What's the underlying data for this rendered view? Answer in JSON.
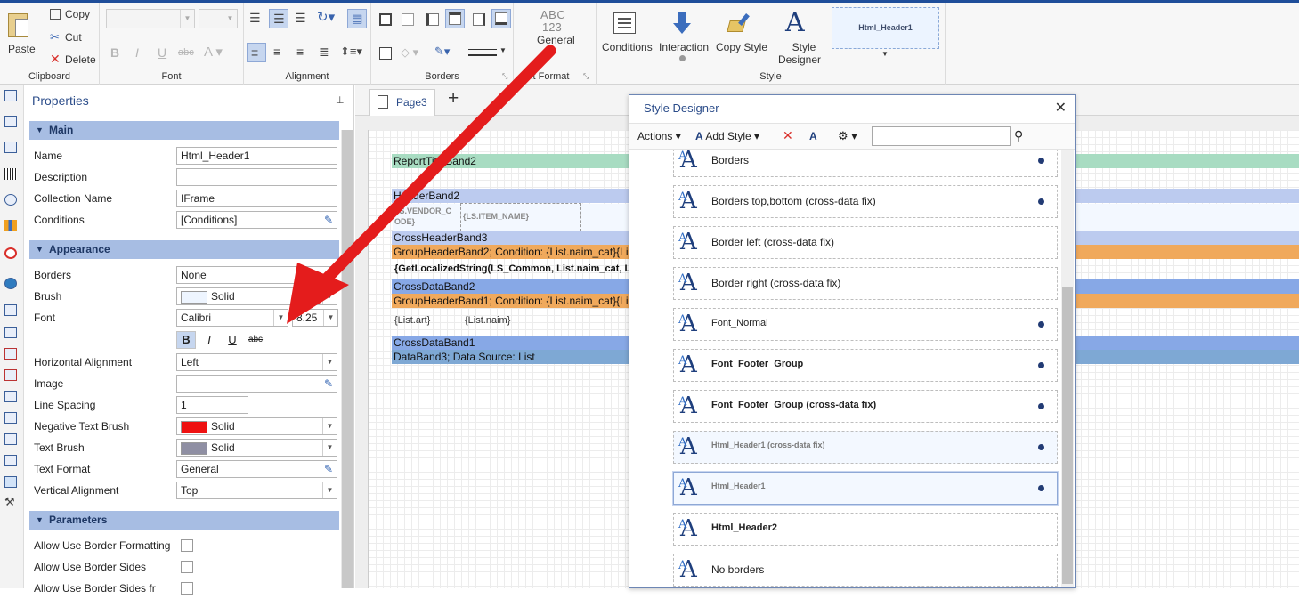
{
  "ribbon": {
    "clipboard": {
      "caption": "Clipboard",
      "paste": "Paste",
      "copy": "Copy",
      "cut": "Cut",
      "delete": "Delete"
    },
    "font": {
      "caption": "Font"
    },
    "alignment": {
      "caption": "Alignment"
    },
    "borders": {
      "caption": "Borders"
    },
    "text_format": {
      "caption": "Text Format",
      "caption_visible": "xt Format",
      "abc": "ABC",
      "num": "123",
      "label": "General"
    },
    "style": {
      "caption": "Style",
      "conditions": "Conditions",
      "interaction": "Interaction",
      "copy_style": "Copy Style",
      "style_designer_1": "Style",
      "style_designer_2": "Designer",
      "preview": "Html_Header1"
    }
  },
  "properties": {
    "title": "Properties",
    "sections": {
      "main": "Main",
      "appearance": "Appearance",
      "parameters": "Parameters"
    },
    "main": [
      {
        "label": "Name",
        "value": "Html_Header1"
      },
      {
        "label": "Description",
        "value": ""
      },
      {
        "label": "Collection Name",
        "value": "IFrame"
      },
      {
        "label": "Conditions",
        "value": "[Conditions]"
      }
    ],
    "appearance": {
      "borders": {
        "label": "Borders",
        "value": "None"
      },
      "brush": {
        "label": "Brush",
        "value": "Solid",
        "color": "#eef5ff"
      },
      "font": {
        "label": "Font",
        "family": "Calibri",
        "size": "8.25"
      },
      "font_style": {
        "bold": "B",
        "italic": "I",
        "underline": "U",
        "strike": "abc"
      },
      "halign": {
        "label": "Horizontal Alignment",
        "value": "Left"
      },
      "image": {
        "label": "Image",
        "value": ""
      },
      "line_spacing": {
        "label": "Line Spacing",
        "value": "1"
      },
      "neg_brush": {
        "label": "Negative Text Brush",
        "value": "Solid",
        "color": "#ee1111"
      },
      "text_brush": {
        "label": "Text Brush",
        "value": "Solid",
        "color": "#8f8fa3"
      },
      "text_format": {
        "label": "Text Format",
        "value": "General"
      },
      "valign": {
        "label": "Vertical Alignment",
        "value": "Top"
      }
    },
    "parameters": [
      {
        "label": "Allow Use Border Formatting"
      },
      {
        "label": "Allow Use Border Sides"
      },
      {
        "label": "Allow Use Border Sides fr"
      }
    ]
  },
  "workspace": {
    "tab": "Page3",
    "plus": "+",
    "bands": [
      {
        "label": "ReportTitleBand2",
        "color": "#a8dcc2"
      },
      {
        "label": "HeaderBand2",
        "color": "#bccbef"
      },
      {
        "label": "CrossHeaderBand3",
        "color": "#bccbef"
      },
      {
        "label": "GroupHeaderBand2; Condition: {List.naim_cat}{Li",
        "color": "#f0a95c"
      },
      {
        "label": "CrossDataBand2",
        "color": "#87a8e6"
      },
      {
        "label": "GroupHeaderBand1; Condition: {List.naim_cat}{Li",
        "color": "#f0a95c"
      },
      {
        "label": "CrossDataBand1",
        "color": "#87a8e6"
      },
      {
        "label": "DataBand3; Data Source: List",
        "color": "#7ea8d4"
      }
    ],
    "cells": {
      "vendor": "LS.VENDOR_C",
      "vendor2": "ODE}",
      "item": "{LS.ITEM_NAME}",
      "localized": "{GetLocalizedString(LS_Common, List.naim_cat, L",
      "art": "{List.art}",
      "naim": "{List.naim}"
    }
  },
  "style_designer": {
    "title": "Style Designer",
    "toolbar": {
      "actions": "Actions",
      "add_style": "Add Style",
      "search_placeholder": ""
    },
    "items": [
      {
        "name": "Borders",
        "dot": true,
        "bold": false,
        "small": false,
        "selected": false
      },
      {
        "name": "Borders top,bottom (cross-data fix)",
        "dot": true,
        "bold": false,
        "small": false,
        "selected": false
      },
      {
        "name": "Border left (cross-data fix)",
        "dot": false,
        "bold": false,
        "small": false,
        "selected": false
      },
      {
        "name": "Border right (cross-data fix)",
        "dot": false,
        "bold": false,
        "small": false,
        "selected": false
      },
      {
        "name": "Font_Normal",
        "dot": true,
        "bold": false,
        "small": true,
        "selected": false
      },
      {
        "name": "Font_Footer_Group",
        "dot": true,
        "bold": true,
        "small": true,
        "selected": false
      },
      {
        "name": "Font_Footer_Group (cross-data fix)",
        "dot": true,
        "bold": true,
        "small": true,
        "selected": false
      },
      {
        "name": "Html_Header1 (cross-data fix)",
        "dot": true,
        "bold": true,
        "small": true,
        "selected": false,
        "tint": true
      },
      {
        "name": "Html_Header1",
        "dot": true,
        "bold": true,
        "small": true,
        "selected": true,
        "tint": true
      },
      {
        "name": "Html_Header2",
        "dot": false,
        "bold": true,
        "small": true,
        "selected": false
      },
      {
        "name": "No borders",
        "dot": false,
        "bold": false,
        "small": false,
        "selected": false
      }
    ]
  },
  "colors": {
    "accent": "#2c4d8a",
    "section": "#a7bde3",
    "arrow": "#e41c1c"
  }
}
